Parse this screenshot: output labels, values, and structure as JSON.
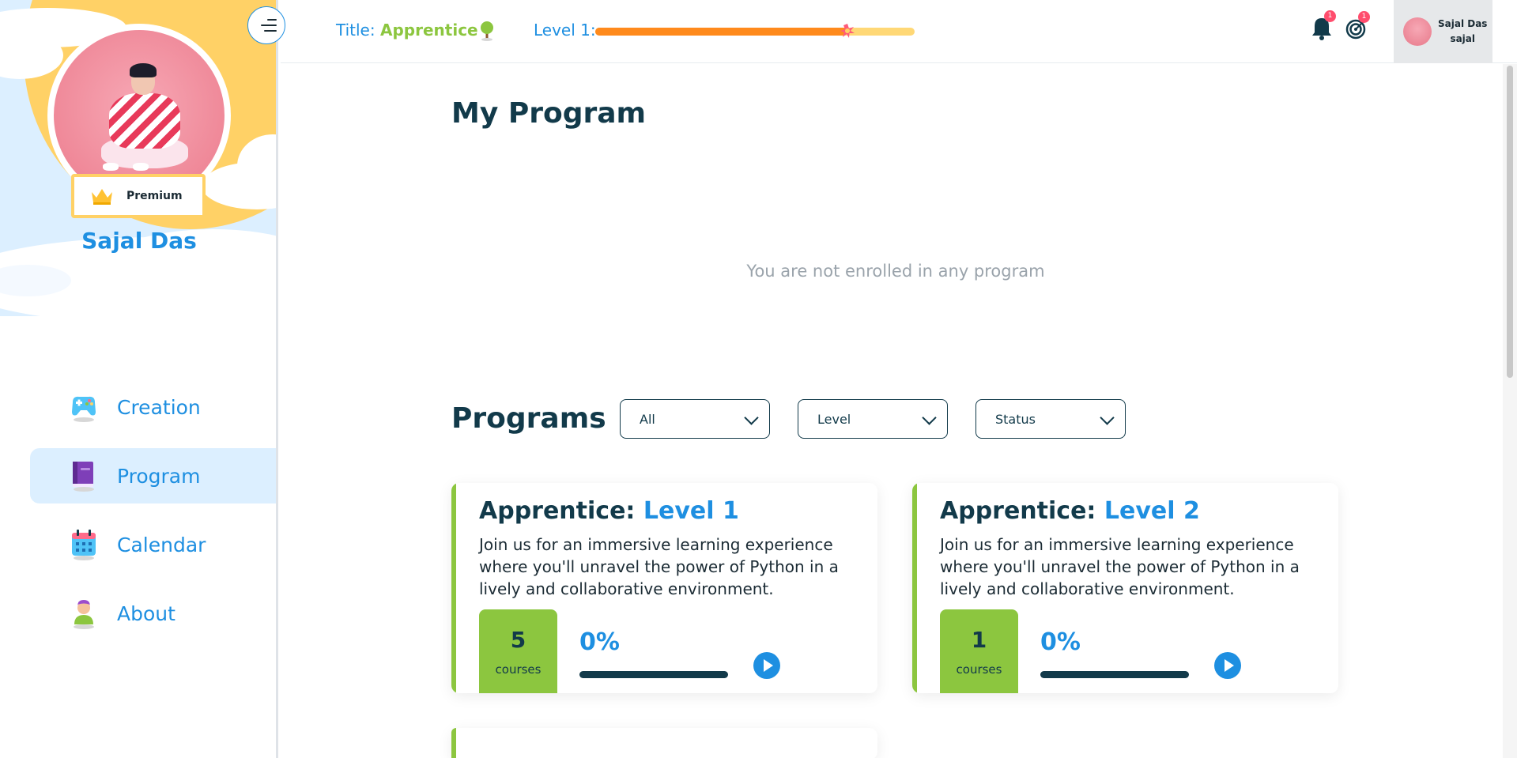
{
  "profile": {
    "name": "Sajal Das",
    "badge": "Premium"
  },
  "nav": {
    "items": [
      {
        "label": "Creation",
        "icon": "gamepad-icon",
        "active": false
      },
      {
        "label": "Program",
        "icon": "book-icon",
        "active": true
      },
      {
        "label": "Calendar",
        "icon": "calendar-icon",
        "active": false
      },
      {
        "label": "About",
        "icon": "person-icon",
        "active": false
      }
    ]
  },
  "header": {
    "title_label": "Title:",
    "title_value": "Apprentice",
    "level_label": "Level 1:",
    "level_progress": 0.79,
    "notifications_count": "1",
    "goals_count": "1",
    "user_name": "Sajal Das",
    "user_handle": "sajal"
  },
  "main": {
    "page_title": "My Program",
    "empty_message": "You are not enrolled in any program",
    "programs_heading": "Programs",
    "filters": [
      {
        "selected": "All"
      },
      {
        "selected": "Level"
      },
      {
        "selected": "Status"
      }
    ],
    "cards": [
      {
        "title_prefix": "Apprentice:",
        "title_level": "Level 1",
        "description": "Join us for an immersive learning experience where you'll unravel the power of Python in a lively and collaborative environment.",
        "courses_count": "5",
        "courses_unit": "courses",
        "progress_label": "0%",
        "progress": 0
      },
      {
        "title_prefix": "Apprentice:",
        "title_level": "Level 2",
        "description": "Join us for an immersive learning experience where you'll unravel the power of Python in a lively and collaborative environment.",
        "courses_count": "1",
        "courses_unit": "courses",
        "progress_label": "0%",
        "progress": 0
      }
    ]
  },
  "colors": {
    "brand_blue": "#1e8fe1",
    "brand_green": "#8cc63f",
    "dark_navy": "#123a4a",
    "level_fill": "#ff8a1c",
    "level_track": "#ffd876"
  }
}
